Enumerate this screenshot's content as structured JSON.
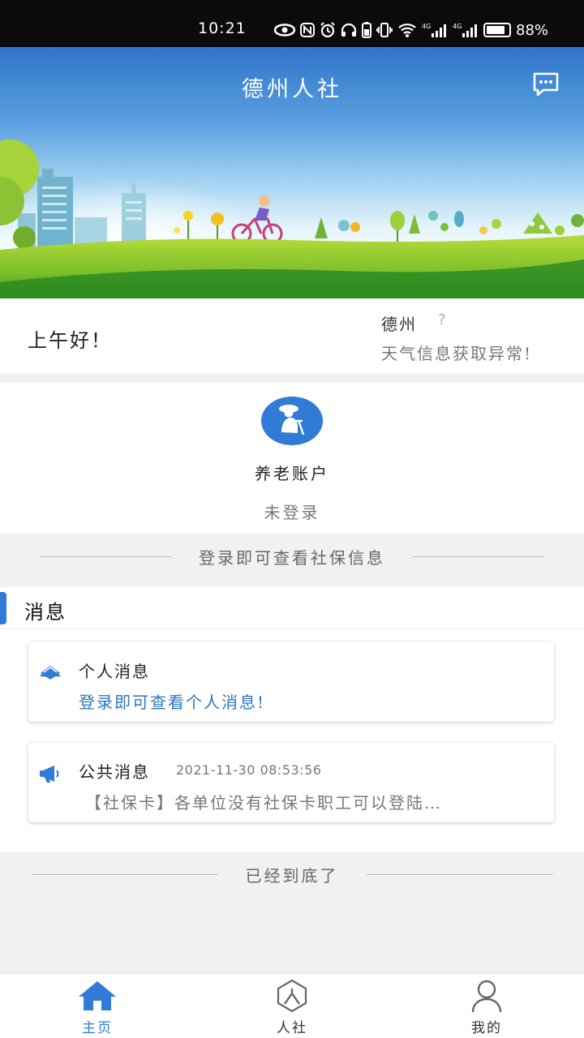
{
  "status_bar": {
    "time": "10:21",
    "network_label": "4G",
    "battery": "88%",
    "battery_level": 0.88
  },
  "header": {
    "title": "德州人社",
    "message_icon": "chat-bubble-icon"
  },
  "greeting": {
    "text": "上午好！",
    "city": "德州",
    "weather_icon": "?",
    "weather_status": "天气信息获取异常!"
  },
  "pension": {
    "label": "养老账户",
    "status": "未登录",
    "icon": "elderly-person-icon",
    "accent_color": "#2f7bd6"
  },
  "login_hint": "登录即可查看社保信息",
  "messages": {
    "section_title": "消息",
    "personal": {
      "title": "个人消息",
      "link": "登录即可查看个人消息!",
      "icon": "envelope-icon"
    },
    "public": {
      "title": "公共消息",
      "time": "2021-11-30 08:53:56",
      "body": "【社保卡】各单位没有社保卡职工可以登陆…",
      "icon": "megaphone-icon"
    }
  },
  "end_text": "已经到底了",
  "nav": {
    "home": "主页",
    "renshe": "人社",
    "mine": "我的",
    "active_color": "#2f7bd6"
  }
}
